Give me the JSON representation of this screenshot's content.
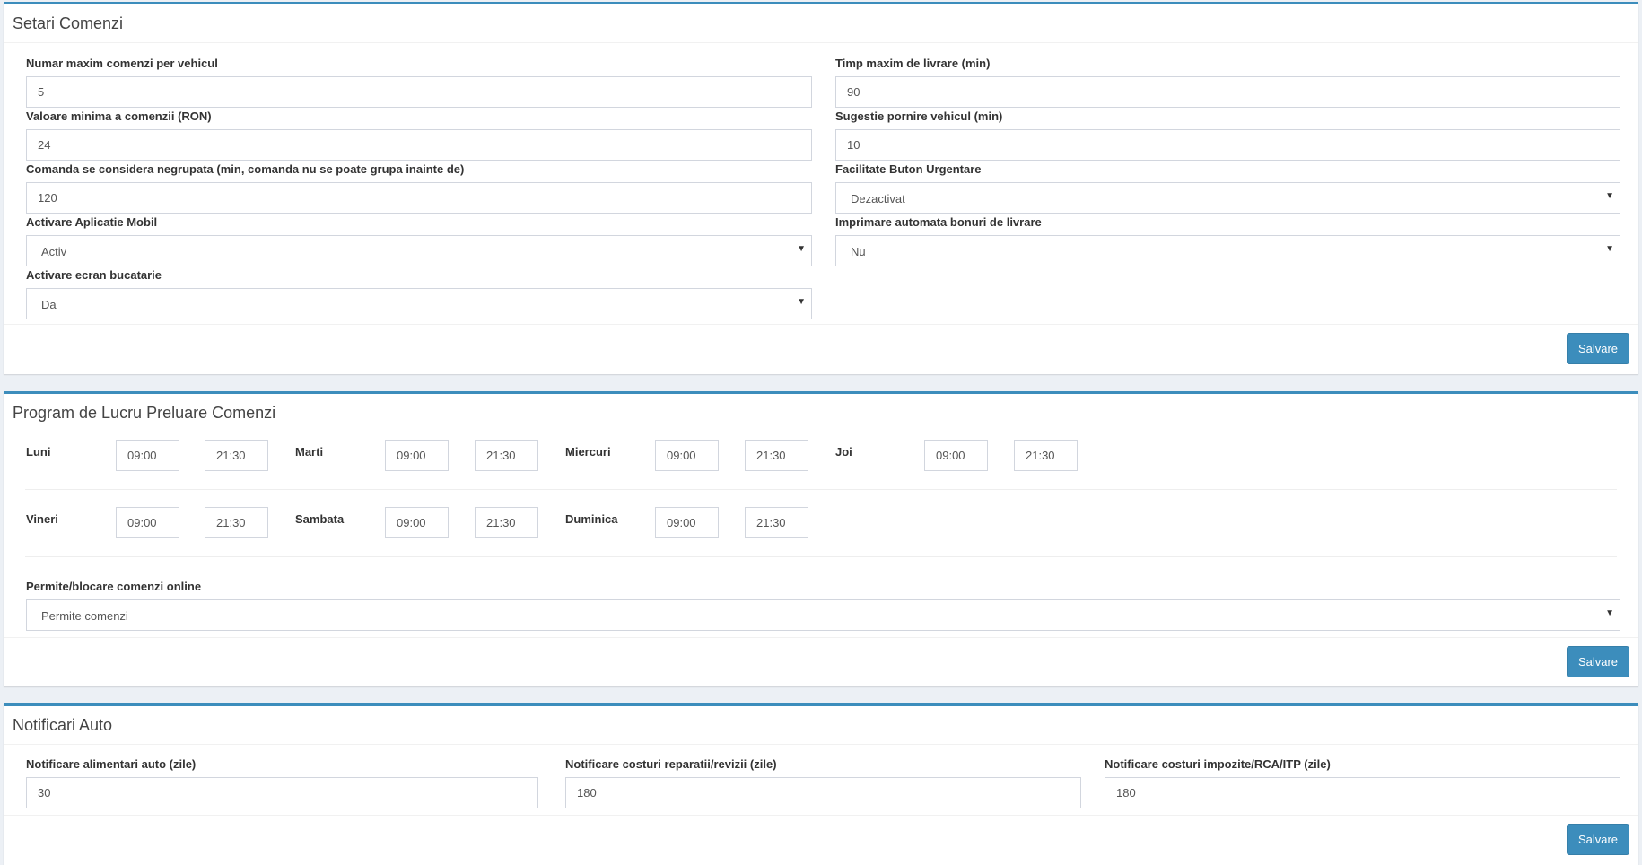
{
  "orders": {
    "title": "Setari Comenzi",
    "max_orders_label": "Numar maxim comenzi per vehicul",
    "max_orders_value": "5",
    "max_delivery_label": "Timp maxim de livrare (min)",
    "max_delivery_value": "90",
    "min_value_label": "Valoare minima a comenzii (RON)",
    "min_value_value": "24",
    "vehicle_start_label": "Sugestie pornire vehicul (min)",
    "vehicle_start_value": "10",
    "ungrouped_label": "Comanda se considera negrupata (min, comanda nu se poate grupa inainte de)",
    "ungrouped_value": "120",
    "urgent_label": "Facilitate Buton Urgentare",
    "urgent_value": "Dezactivat",
    "mobile_label": "Activare Aplicatie Mobil",
    "mobile_value": "Activ",
    "autoprint_label": "Imprimare automata bonuri de livrare",
    "autoprint_value": "Nu",
    "kitchen_label": "Activare ecran bucatarie",
    "kitchen_value": "Da",
    "save_label": "Salvare"
  },
  "schedule": {
    "title": "Program de Lucru Preluare Comenzi",
    "days": [
      {
        "name": "Luni",
        "start": "09:00",
        "end": "21:30"
      },
      {
        "name": "Marti",
        "start": "09:00",
        "end": "21:30"
      },
      {
        "name": "Miercuri",
        "start": "09:00",
        "end": "21:30"
      },
      {
        "name": "Joi",
        "start": "09:00",
        "end": "21:30"
      },
      {
        "name": "Vineri",
        "start": "09:00",
        "end": "21:30"
      },
      {
        "name": "Sambata",
        "start": "09:00",
        "end": "21:30"
      },
      {
        "name": "Duminica",
        "start": "09:00",
        "end": "21:30"
      }
    ],
    "online_label": "Permite/blocare comenzi online",
    "online_value": "Permite comenzi",
    "save_label": "Salvare"
  },
  "notifications": {
    "title": "Notificari Auto",
    "fuel_label": "Notificare alimentari auto (zile)",
    "fuel_value": "30",
    "repairs_label": "Notificare costuri reparatii/revizii (zile)",
    "repairs_value": "180",
    "taxes_label": "Notificare costuri impozite/RCA/ITP (zile)",
    "taxes_value": "180",
    "save_label": "Salvare"
  },
  "theme": {
    "accent": "#3c8dbc",
    "background": "#ecf0f5",
    "border": "#d2d6de"
  }
}
